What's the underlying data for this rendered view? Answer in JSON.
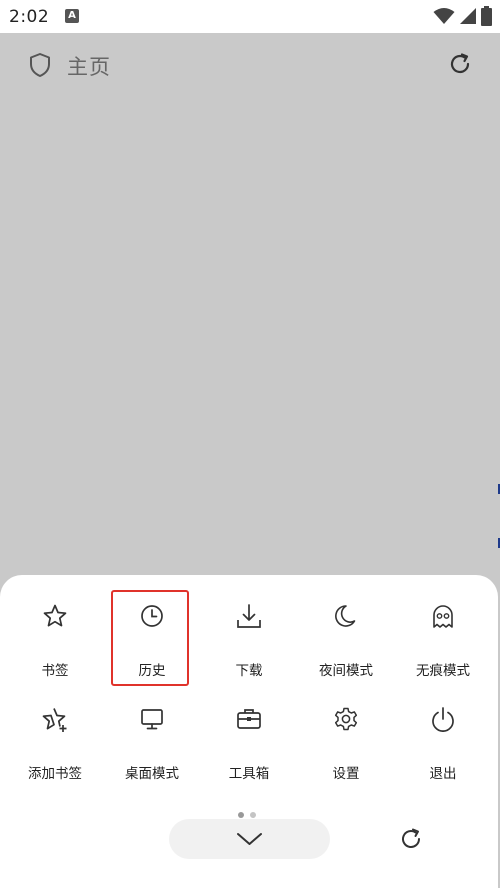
{
  "status_bar": {
    "time": "2:02",
    "app_icon_letter": "A"
  },
  "header": {
    "title": "主页"
  },
  "menu": {
    "row1": [
      {
        "label": "书签",
        "icon": "star-icon"
      },
      {
        "label": "历史",
        "icon": "clock-icon"
      },
      {
        "label": "下载",
        "icon": "download-icon"
      },
      {
        "label": "夜间模式",
        "icon": "moon-icon"
      },
      {
        "label": "无痕模式",
        "icon": "ghost-icon"
      }
    ],
    "row2": [
      {
        "label": "添加书签",
        "icon": "star-plus-icon"
      },
      {
        "label": "桌面模式",
        "icon": "monitor-icon"
      },
      {
        "label": "工具箱",
        "icon": "toolbox-icon"
      },
      {
        "label": "设置",
        "icon": "gear-icon"
      },
      {
        "label": "退出",
        "icon": "power-icon"
      }
    ]
  },
  "pager": {
    "pages": 2,
    "current": 1
  },
  "colors": {
    "highlight": "#e0332b",
    "background_dim": "#c9c9c9",
    "sheet": "#ffffff",
    "dot_active": "#999999",
    "dot_inactive": "#c4c4c4"
  }
}
